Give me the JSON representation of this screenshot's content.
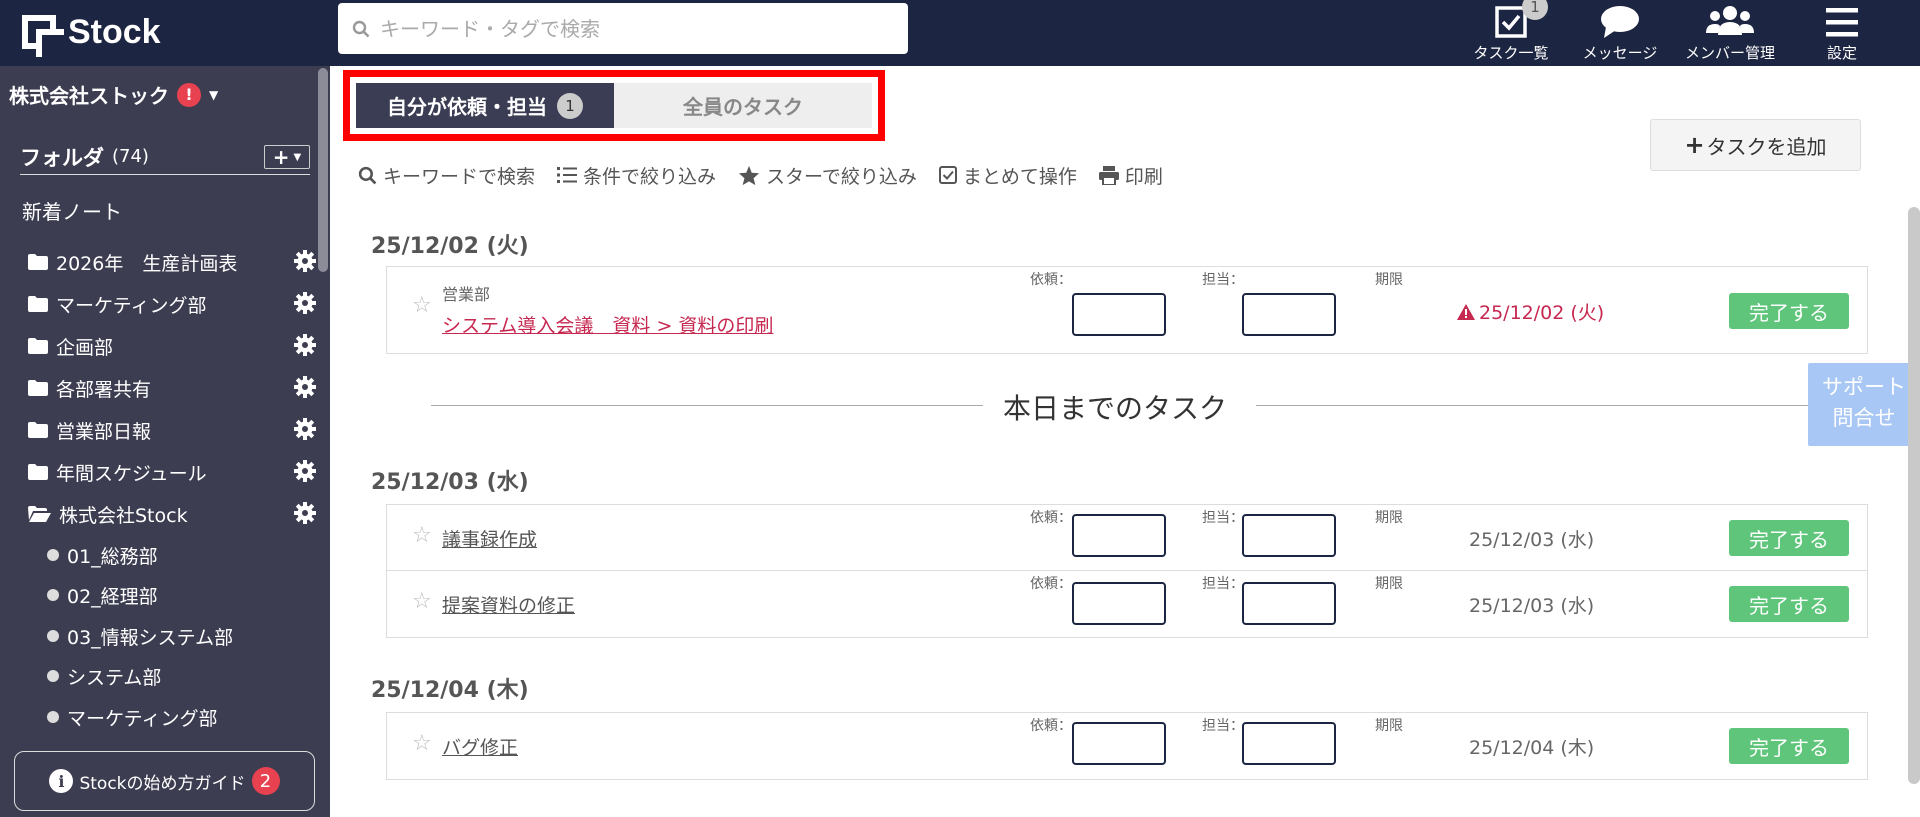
{
  "header": {
    "logo_text": "Stock",
    "search_placeholder": "キーワード・タグで検索",
    "nav": [
      {
        "label": "タスク一覧",
        "icon": "checkbox-icon",
        "badge": "1"
      },
      {
        "label": "メッセージ",
        "icon": "chat-bubble-icon"
      },
      {
        "label": "メンバー管理",
        "icon": "members-icon"
      },
      {
        "label": "設定",
        "icon": "hamburger-menu-icon"
      }
    ]
  },
  "sidebar": {
    "company": "株式会社ストック",
    "alert": "!",
    "folder_heading": "フォルダ",
    "folder_count": "(74)",
    "new_note": "新着ノート",
    "folders": [
      {
        "name": "2026年　生産計画表",
        "icon": "folder-icon"
      },
      {
        "name": "マーケティング部",
        "icon": "folder-icon"
      },
      {
        "name": "企画部",
        "icon": "folder-icon"
      },
      {
        "name": "各部署共有",
        "icon": "folder-icon"
      },
      {
        "name": "営業部日報",
        "icon": "folder-icon"
      },
      {
        "name": "年間スケジュール",
        "icon": "folder-icon"
      },
      {
        "name": "株式会社Stock",
        "icon": "folder-open-icon"
      }
    ],
    "subfolders": [
      "01_総務部",
      "02_経理部",
      "03_情報システム部",
      "システム部",
      "マーケティング部"
    ],
    "guide_label": "Stockの始め方ガイド",
    "guide_badge": "2"
  },
  "main": {
    "tab_mine": "自分が依頼・担当",
    "tab_mine_count": "1",
    "tab_all": "全員のタスク",
    "add_task": "タスクを追加",
    "toolbar": [
      "キーワードで検索",
      "条件で絞り込み",
      "スターで絞り込み",
      "まとめて操作",
      "印刷"
    ],
    "field_labels": {
      "requester": "依頼：",
      "assignee": "担当：",
      "due": "期限"
    },
    "done_label": "完了する",
    "today_divider": "本日までのタスク",
    "groups": [
      {
        "date": "25/12/02 (火)",
        "tasks": [
          {
            "category": "営業部",
            "title": "システム導入会議　資料 > 資料の印刷",
            "due": "25/12/02 (火)",
            "overdue": true
          }
        ]
      },
      {
        "date": "25/12/03 (水)",
        "tasks": [
          {
            "title": "議事録作成",
            "due": "25/12/03 (水)"
          },
          {
            "title": "提案資料の修正",
            "due": "25/12/03 (水)"
          }
        ]
      },
      {
        "date": "25/12/04 (木)",
        "tasks": [
          {
            "title": "バグ修正",
            "due": "25/12/04 (木)"
          }
        ]
      }
    ]
  },
  "support": {
    "line1": "サポート",
    "line2": "問合せ"
  },
  "colors": {
    "header_bg": "#1c2541",
    "sidebar_bg": "#3d3d52",
    "accent_red": "#c62850",
    "done_green": "#5ec57a",
    "highlight": "#ff0000"
  }
}
